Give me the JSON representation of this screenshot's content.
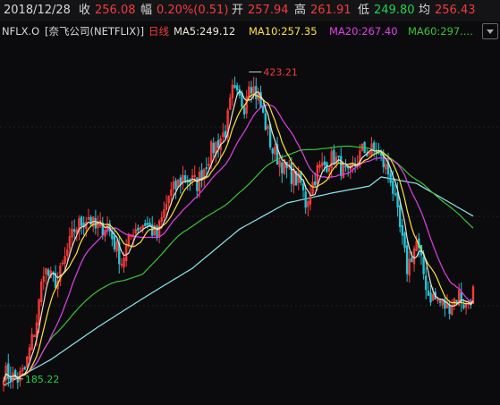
{
  "header": {
    "date": "2018/12/28",
    "close_label": "收",
    "close_value": "256.08",
    "change_label": "幅",
    "change_value": "0.20%(0.51)",
    "open_label": "开",
    "open_value": "257.94",
    "high_label": "高",
    "high_value": "261.91",
    "low_label": "低",
    "low_value": "249.80",
    "avg_label": "均",
    "avg_value": "256.43"
  },
  "legend": {
    "ticker": "NFLX.O",
    "name": "[奈飞公司(NETFLIX)]",
    "period": "日线",
    "ma5": "MA5:249.12",
    "ma10": "MA10:257.35",
    "ma20": "MA20:267.40",
    "ma60": "MA60:297...."
  },
  "colors": {
    "up": "#ff3b3b",
    "down": "#25c5d6",
    "ma5": "#e8e0d0",
    "ma10": "#ffe23a",
    "ma20": "#e040e8",
    "ma60": "#3ac23a",
    "ma250": "#8ce8ee"
  },
  "chart_data": {
    "type": "candlestick",
    "annotations": {
      "high_label": "423.21",
      "low_label": "185.22"
    },
    "y_range": [
      170,
      440
    ],
    "series": [
      {
        "name": "MA5",
        "last": 249.12
      },
      {
        "name": "MA10",
        "last": 257.35
      },
      {
        "name": "MA20",
        "last": 267.4
      },
      {
        "name": "MA60",
        "last": 297
      }
    ],
    "close_anchors": [
      [
        0,
        190
      ],
      [
        6,
        185
      ],
      [
        9,
        192
      ],
      [
        14,
        230
      ],
      [
        17,
        270
      ],
      [
        20,
        262
      ],
      [
        23,
        260
      ],
      [
        30,
        300
      ],
      [
        36,
        310
      ],
      [
        39,
        300
      ],
      [
        44,
        303
      ],
      [
        50,
        275
      ],
      [
        55,
        300
      ],
      [
        60,
        305
      ],
      [
        65,
        295
      ],
      [
        70,
        325
      ],
      [
        76,
        340
      ],
      [
        82,
        335
      ],
      [
        88,
        360
      ],
      [
        94,
        375
      ],
      [
        97,
        405
      ],
      [
        102,
        395
      ],
      [
        104,
        415
      ],
      [
        108,
        400
      ],
      [
        114,
        360
      ],
      [
        120,
        345
      ],
      [
        126,
        335
      ],
      [
        128,
        320
      ],
      [
        133,
        345
      ],
      [
        140,
        355
      ],
      [
        146,
        340
      ],
      [
        152,
        360
      ],
      [
        158,
        360
      ],
      [
        164,
        340
      ],
      [
        168,
        300
      ],
      [
        171,
        270
      ],
      [
        175,
        290
      ],
      [
        180,
        250
      ],
      [
        188,
        240
      ],
      [
        193,
        250
      ],
      [
        196,
        240
      ],
      [
        199,
        252
      ]
    ],
    "ma250_anchors": [
      [
        0,
        180
      ],
      [
        20,
        200
      ],
      [
        40,
        225
      ],
      [
        60,
        248
      ],
      [
        80,
        270
      ],
      [
        100,
        300
      ],
      [
        120,
        320
      ],
      [
        140,
        328
      ],
      [
        155,
        333
      ],
      [
        160,
        340
      ],
      [
        175,
        335
      ],
      [
        199,
        310
      ]
    ]
  }
}
